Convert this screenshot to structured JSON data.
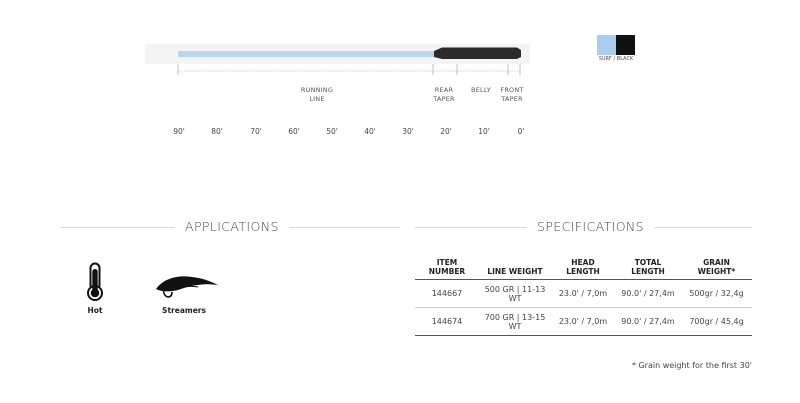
{
  "line_diagram": {
    "segments": [
      {
        "name": "running-line",
        "label_lines": [
          "RUNNING",
          "LINE"
        ]
      },
      {
        "name": "rear-taper",
        "label_lines": [
          "REAR",
          "TAPER"
        ]
      },
      {
        "name": "belly",
        "label_lines": [
          "BELLY"
        ]
      },
      {
        "name": "front-taper",
        "label_lines": [
          "FRONT",
          "TAPER"
        ]
      }
    ],
    "ticks": [
      "90'",
      "80'",
      "70'",
      "60'",
      "50'",
      "40'",
      "30'",
      "20'",
      "10'",
      "0'"
    ],
    "swatch": {
      "label": "SURF / BLACK",
      "colors": [
        "#a9cdee",
        "#111111"
      ]
    },
    "colors": {
      "running_line": "#b9d6f0",
      "head": "#2b2b2b"
    }
  },
  "applications": {
    "title": "APPLICATIONS",
    "items": [
      {
        "label": "Hot",
        "icon": "thermometer-icon"
      },
      {
        "label": "Streamers",
        "icon": "streamer-fly-icon"
      }
    ]
  },
  "specifications": {
    "title": "SPECIFICATIONS",
    "headers": [
      [
        "ITEM",
        "NUMBER"
      ],
      [
        "LINE WEIGHT"
      ],
      [
        "HEAD",
        "LENGTH"
      ],
      [
        "TOTAL",
        "LENGTH"
      ],
      [
        "GRAIN",
        "WEIGHT*"
      ]
    ],
    "rows": [
      {
        "item": "144667",
        "weight": [
          "500 GR | 11-13",
          "WT"
        ],
        "head": "23.0' / 7,0m",
        "total": "90.0' / 27,4m",
        "grain": "500gr / 32,4g"
      },
      {
        "item": "144674",
        "weight": [
          "700 GR | 13-15",
          "WT"
        ],
        "head": "23.0' / 7,0m",
        "total": "90.0' / 27,4m",
        "grain": "700gr / 45,4g"
      }
    ],
    "footnote": "* Grain weight for the first 30'"
  }
}
